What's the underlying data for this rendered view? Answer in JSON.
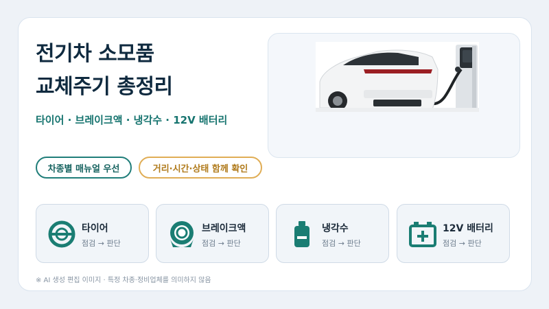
{
  "title_lines": [
    "전기차 소모품",
    "교체주기 총정리"
  ],
  "subtitle": "타이어 · 브레이크액 · 냉각수 · 12V 배터리",
  "tags": {
    "manual": "차종별 매뉴얼 우선",
    "check": "거리·시간·상태 함께 확인"
  },
  "items": [
    {
      "name": "타이어",
      "sub": "점검 → 판단",
      "icon": "tire-icon"
    },
    {
      "name": "브레이크액",
      "sub": "점검 → 판단",
      "icon": "brake-disc-icon"
    },
    {
      "name": "냉각수",
      "sub": "점검 → 판단",
      "icon": "coolant-bottle-icon"
    },
    {
      "name": "12V 배터리",
      "sub": "점검 → 판단",
      "icon": "battery-icon"
    }
  ],
  "footnote": "※ AI 생성 편집 이미지 · 특정 차종·정비업체를 의미하지 않음",
  "colors": {
    "accent_teal": "#1f7d79",
    "accent_amber": "#e0ad55",
    "title": "#0f2a3f"
  }
}
